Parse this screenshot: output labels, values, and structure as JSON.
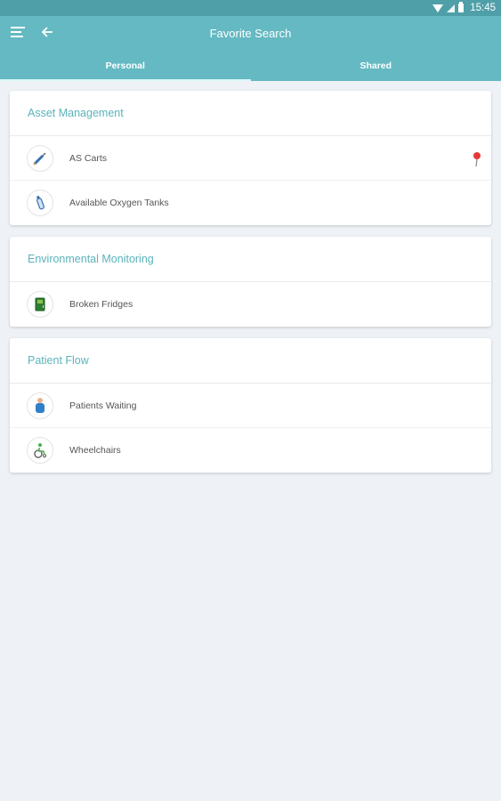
{
  "status_bar": {
    "time": "15:45"
  },
  "header": {
    "title": "Favorite Search"
  },
  "tabs": [
    {
      "label": "Personal",
      "active": true
    },
    {
      "label": "Shared",
      "active": false
    }
  ],
  "groups": [
    {
      "title": "Asset Management",
      "items": [
        {
          "label": "AS Carts",
          "icon": "syringe-icon",
          "pinned": true
        },
        {
          "label": "Available Oxygen Tanks",
          "icon": "oxygen-tank-icon",
          "pinned": false
        }
      ]
    },
    {
      "title": "Environmental Monitoring",
      "items": [
        {
          "label": "Broken Fridges",
          "icon": "fridge-icon",
          "pinned": false
        }
      ]
    },
    {
      "title": "Patient Flow",
      "items": [
        {
          "label": "Patients Waiting",
          "icon": "patient-icon",
          "pinned": false
        },
        {
          "label": "Wheelchairs",
          "icon": "wheelchair-icon",
          "pinned": false
        }
      ]
    }
  ],
  "colors": {
    "status_bar": "#4f9fa8",
    "app_bar": "#64b9c2",
    "accent": "#5ab3bb",
    "background": "#eef2f6",
    "pin": "#e53935"
  }
}
